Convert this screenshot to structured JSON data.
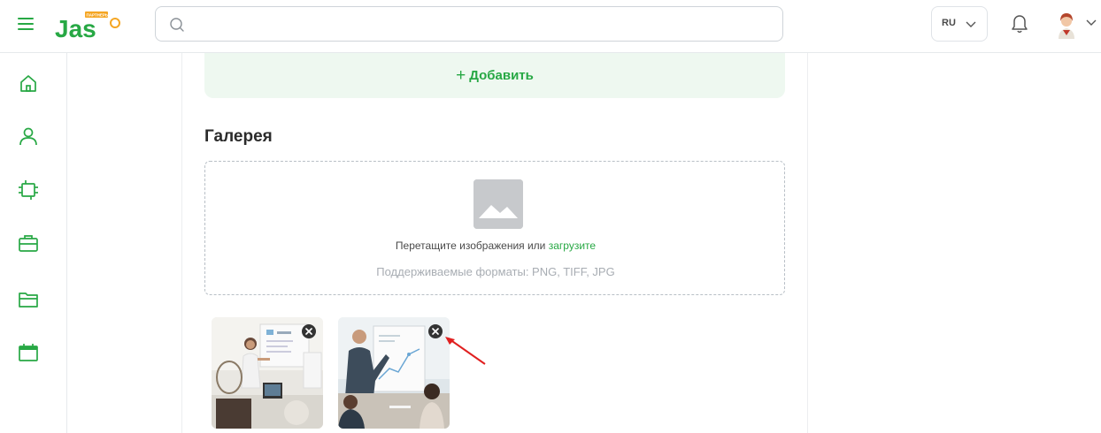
{
  "header": {
    "menu_icon": "hamburger-icon",
    "logo_text": "Jas",
    "logo_badge": "ПАРТНЕРЫ",
    "search": {
      "placeholder": "",
      "value": ""
    },
    "language": {
      "code": "RU"
    },
    "notifications_icon": "bell-icon",
    "avatar_icon": "user-avatar"
  },
  "sidebar": {
    "items": [
      {
        "icon": "home-icon"
      },
      {
        "icon": "user-icon"
      },
      {
        "icon": "chip-icon"
      },
      {
        "icon": "briefcase-icon"
      },
      {
        "icon": "folder-icon"
      },
      {
        "icon": "calendar-icon"
      }
    ]
  },
  "main": {
    "add_button": {
      "plus": "+",
      "label": "Добавить"
    },
    "gallery": {
      "title": "Галерея",
      "dropzone": {
        "text": "Перетащите изображения или",
        "link": "загрузите",
        "formats": "Поддерживаемые форматы: PNG, TIFF, JPG"
      },
      "images": [
        {
          "description": "woman-presenting-at-whiteboard",
          "remove_icon": "close-icon"
        },
        {
          "description": "man-presenting-chart-to-team",
          "remove_icon": "close-icon"
        }
      ]
    }
  },
  "colors": {
    "accent": "#27a844",
    "accent_light": "#eef8f0",
    "annotation_arrow": "#e02020"
  }
}
